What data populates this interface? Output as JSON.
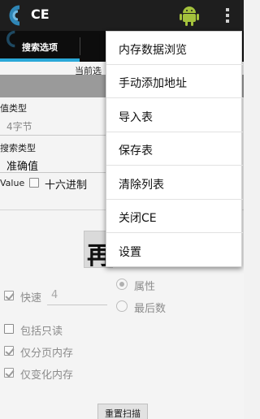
{
  "app": {
    "title": "CE"
  },
  "tabs": [
    {
      "label": "搜索选项"
    }
  ],
  "form": {
    "current_label": "当前选",
    "value_type_label": "值类型",
    "value_type_value": "4字节",
    "search_type_label": "搜索类型",
    "search_type_value": "准确值",
    "value_label": "Value",
    "hex_label": "十六进制",
    "big_button_text": "再",
    "fast_label": "快速",
    "fast_value": "4",
    "attr_label": "属性",
    "last_digit_label": "最后数",
    "readonly_label": "包括只读",
    "paged_only_label": "仅分页内存",
    "changed_only_label": "仅变化内存",
    "reset_button_label": "重置扫描"
  },
  "menu": {
    "items": [
      {
        "label": "内存数据浏览"
      },
      {
        "label": "手动添加地址"
      },
      {
        "label": "导入表"
      },
      {
        "label": "保存表"
      },
      {
        "label": "清除列表"
      },
      {
        "label": "关闭CE"
      },
      {
        "label": "设置"
      }
    ]
  },
  "colors": {
    "actionbar": "#1e1e1e",
    "tabbar": "#0d0d0d",
    "tab_accent": "#2aa8d8",
    "band": "#9a9a9a",
    "menu_bg": "#ffffff"
  },
  "icons": {
    "app_logo": "ce-logo-icon",
    "android": "android-icon",
    "overflow": "overflow-menu-icon"
  }
}
